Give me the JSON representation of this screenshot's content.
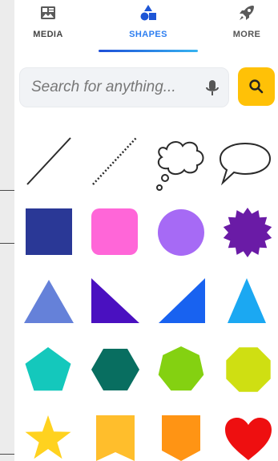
{
  "tabs": {
    "media": {
      "label": "MEDIA",
      "icon": "media-icon"
    },
    "shapes": {
      "label": "SHAPES",
      "icon": "shapes-icon",
      "active": true
    },
    "more": {
      "label": "MORE",
      "icon": "rocket-icon"
    }
  },
  "search": {
    "placeholder": "Search for anything...",
    "value": "",
    "mic_icon": "microphone-icon",
    "button_icon": "search-icon"
  },
  "colors": {
    "accent": "#2d7ef0",
    "search_button": "#ffc107"
  },
  "shapes": [
    {
      "name": "line",
      "color": "#2b2b2b"
    },
    {
      "name": "dotted-line",
      "color": "#2b2b2b"
    },
    {
      "name": "thought-bubble",
      "color": "#2b2b2b"
    },
    {
      "name": "speech-bubble",
      "color": "#2b2b2b"
    },
    {
      "name": "square",
      "color": "#2a3896"
    },
    {
      "name": "rounded-square",
      "color": "#ff66d8"
    },
    {
      "name": "circle",
      "color": "#a66af5"
    },
    {
      "name": "starburst",
      "color": "#6a1ba6"
    },
    {
      "name": "triangle",
      "color": "#6581d9"
    },
    {
      "name": "right-triangle",
      "color": "#4a10c0"
    },
    {
      "name": "right-triangle-mirrored",
      "color": "#1862f0"
    },
    {
      "name": "acute-triangle",
      "color": "#1ba8f2"
    },
    {
      "name": "pentagon",
      "color": "#14c8bc"
    },
    {
      "name": "hexagon",
      "color": "#086e60"
    },
    {
      "name": "heptagon",
      "color": "#84d111"
    },
    {
      "name": "octagon",
      "color": "#cfdf12"
    },
    {
      "name": "star",
      "color": "#ffd21f"
    },
    {
      "name": "ribbon-banner",
      "color": "#ffbe2c"
    },
    {
      "name": "pointed-banner",
      "color": "#ff9414"
    },
    {
      "name": "heart",
      "color": "#ee0f10"
    }
  ]
}
